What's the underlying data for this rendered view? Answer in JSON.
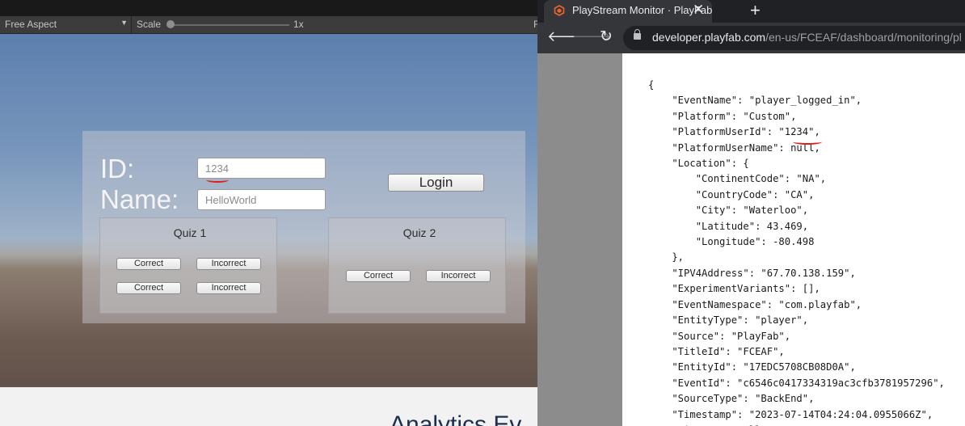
{
  "unity": {
    "toolbar": {
      "aspect": "Free Aspect",
      "scale_label": "Scale",
      "scale_value": "1x",
      "edge_label": "F"
    },
    "form": {
      "id_label": "ID:",
      "name_label": "Name:",
      "id_value": "1234",
      "name_placeholder": "HelloWorld",
      "login_label": "Login"
    },
    "quiz1": {
      "title": "Quiz 1",
      "correct": "Correct",
      "incorrect": "Incorrect"
    },
    "quiz2": {
      "title": "Quiz 2",
      "correct": "Correct",
      "incorrect": "Incorrect"
    },
    "background_text": "Analytics Ev"
  },
  "browser": {
    "tab_title": "PlayStream Monitor · PlayFab",
    "url_host": "developer.playfab.com",
    "url_path": "/en-us/FCEAF/dashboard/monitoring/pl",
    "json_lines": [
      "{",
      "    \"EventName\": \"player_logged_in\",",
      "    \"Platform\": \"Custom\",",
      "    \"PlatformUserId\": \"1234\",",
      "    \"PlatformUserName\": null,",
      "    \"Location\": {",
      "        \"ContinentCode\": \"NA\",",
      "        \"CountryCode\": \"CA\",",
      "        \"City\": \"Waterloo\",",
      "        \"Latitude\": 43.469,",
      "        \"Longitude\": -80.498",
      "    },",
      "    \"IPV4Address\": \"67.70.138.159\",",
      "    \"ExperimentVariants\": [],",
      "    \"EventNamespace\": \"com.playfab\",",
      "    \"EntityType\": \"player\",",
      "    \"Source\": \"PlayFab\",",
      "    \"TitleId\": \"FCEAF\",",
      "    \"EntityId\": \"17EDC5708CB08D0A\",",
      "    \"EventId\": \"c6546c0417334319ac3cfb3781957296\",",
      "    \"SourceType\": \"BackEnd\",",
      "    \"Timestamp\": \"2023-07-14T04:24:04.0955066Z\",",
      "    \"History\": null,"
    ]
  },
  "colors": {
    "annotation_red": "#e01e1e",
    "chrome_dark": "#35363a",
    "playfab_orange": "#f0642b"
  }
}
